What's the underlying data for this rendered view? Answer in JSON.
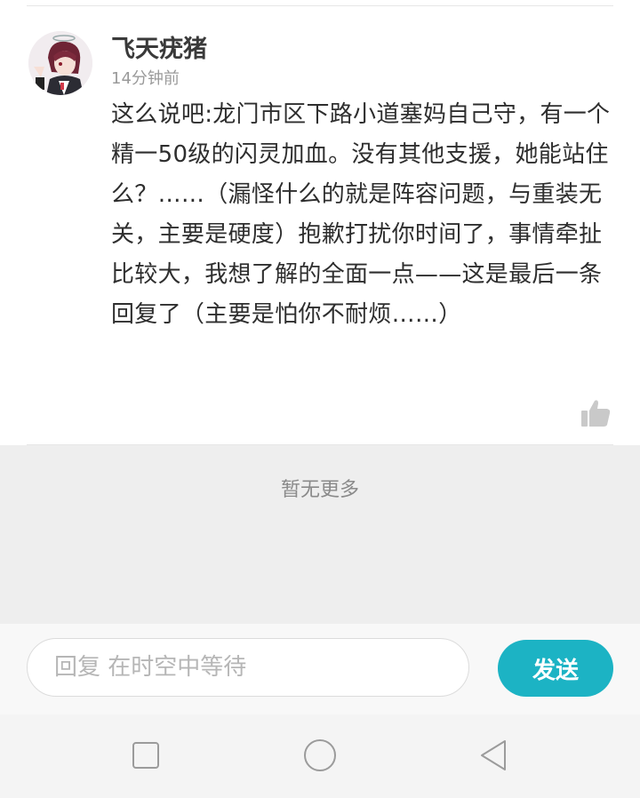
{
  "comment": {
    "username": "飞天疣猪",
    "timestamp": "14分钟前",
    "text": "这么说吧:龙门市区下路小道塞妈自己守，有一个精一50级的闪灵加血。没有其他支援，她能站住么？……（漏怪什么的就是阵容问题，与重装无关，主要是硬度）抱歉打扰你时间了，事情牵扯比较大，我想了解的全面一点——这是最后一条回复了（主要是怕你不耐烦……）",
    "like_icon": "thumbs-up-icon"
  },
  "list_footer": {
    "no_more_text": "暂无更多"
  },
  "reply": {
    "placeholder": "回复 在时空中等待",
    "value": "",
    "send_label": "发送",
    "accent_color": "#1cb3c4"
  },
  "navbar": {
    "icons": [
      "square-recents-icon",
      "circle-home-icon",
      "triangle-back-icon"
    ]
  }
}
